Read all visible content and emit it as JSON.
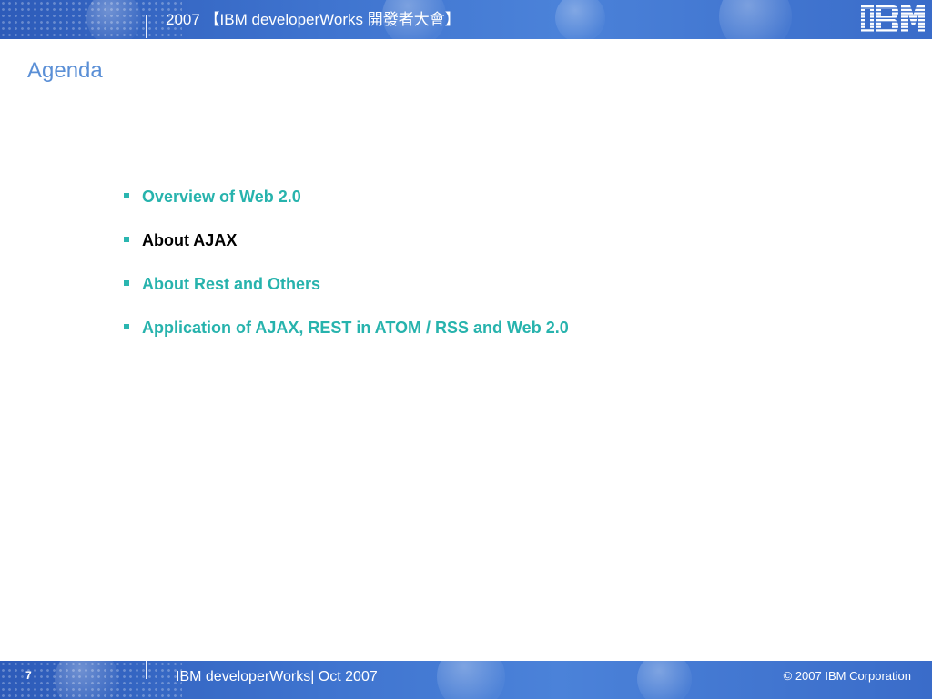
{
  "header": {
    "title": "2007 【IBM developerWorks 開發者大會】",
    "logo_text": "IBM"
  },
  "slide": {
    "title": "Agenda"
  },
  "agenda": {
    "items": [
      {
        "label": "Overview of Web 2.0",
        "active": false
      },
      {
        "label": "About AJAX",
        "active": true
      },
      {
        "label": "About Rest and Others",
        "active": false
      },
      {
        "label": "Application of AJAX, REST in ATOM / RSS and Web 2.0",
        "active": false
      }
    ]
  },
  "footer": {
    "page_number": "7",
    "center_text": "IBM developerWorks| Oct 2007",
    "copyright": "© 2007 IBM Corporation"
  },
  "colors": {
    "band_blue": "#3f74cf",
    "title_blue": "#5a8fd6",
    "accent_teal": "#27b3ad",
    "active_text": "#000000"
  }
}
